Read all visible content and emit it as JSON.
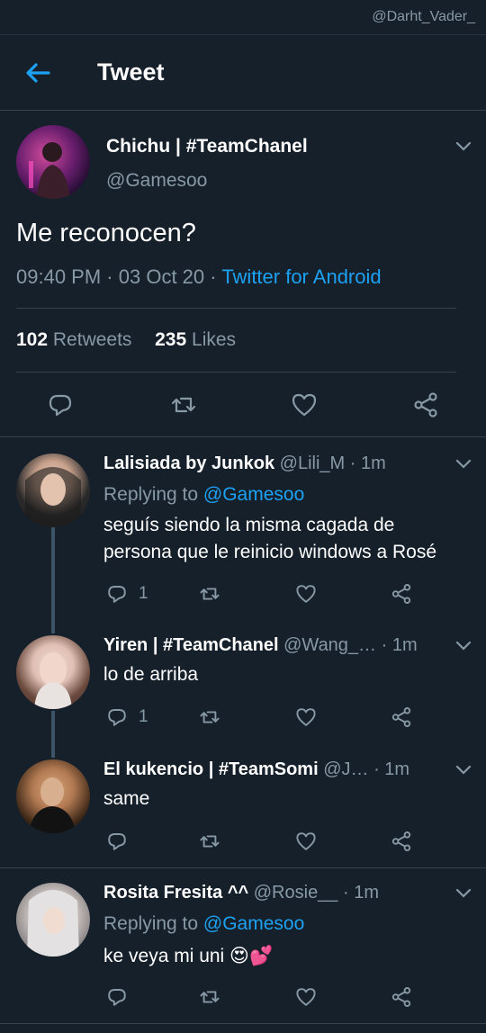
{
  "watermark": "@Darht_Vader_",
  "header": {
    "title": "Tweet",
    "back_icon": "arrow-left-icon"
  },
  "colors": {
    "background": "#15202b",
    "accent": "#1da1f2",
    "muted": "#8899a6",
    "divider": "#38444d"
  },
  "tweet": {
    "name": "Chichu | #TeamChanel",
    "handle": "@Gamesoo",
    "text": "Me reconocen?",
    "time": "09:40 PM",
    "date": "03 Oct 20",
    "source": "Twitter for Android",
    "retweets_count": "102",
    "retweets_label": "Retweets",
    "likes_count": "235",
    "likes_label": "Likes"
  },
  "replies": [
    {
      "name": "Lalisiada by Junkok",
      "handle": "@Lili_M",
      "time": "· 1m",
      "replying_prefix": "Replying to",
      "replying_to": "@Gamesoo",
      "text_lines": [
        "seguís siendo la misma cagada de",
        "persona que le reinicio windows a Rosé"
      ],
      "reply_count": "1"
    },
    {
      "name": "Yiren | #TeamChanel",
      "handle": "@Wang_…",
      "time": "· 1m",
      "text": "lo de arriba",
      "reply_count": "1"
    },
    {
      "name": "El kukencio | #TeamSomi",
      "handle": "@J…",
      "time": "· 1m",
      "text": "same",
      "reply_count": ""
    },
    {
      "name": "Rosita Fresita ^^",
      "handle": "@Rosie__",
      "time": "· 1m",
      "replying_prefix": "Replying to",
      "replying_to": "@Gamesoo",
      "text": "ke veya mi uni 😍💕",
      "reply_count": ""
    }
  ]
}
